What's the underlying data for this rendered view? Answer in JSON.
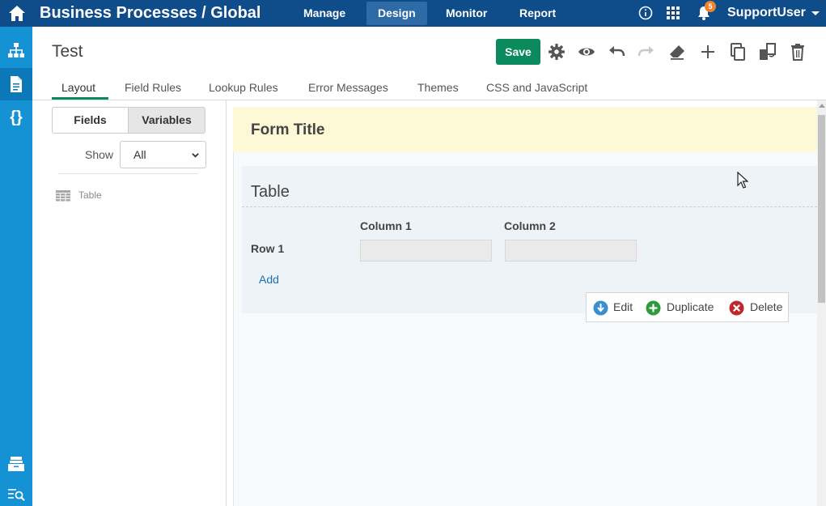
{
  "app": {
    "title": "Business Processes",
    "scope": "/ Global",
    "nav": [
      "Manage",
      "Design",
      "Monitor",
      "Report"
    ],
    "active_nav": "Design",
    "notifications_count": "5",
    "user": "SupportUser"
  },
  "rail": {
    "icons": [
      "hierarchy-icon",
      "document-icon",
      "braces-icon",
      "archive-icon",
      "search-list-icon"
    ],
    "active": "document-icon"
  },
  "header": {
    "page_title": "Test",
    "save_label": "Save",
    "tools": [
      "gear-icon",
      "eye-icon",
      "undo-icon",
      "redo-icon",
      "eraser-icon",
      "plus-icon",
      "copy-icon",
      "sync-icon",
      "trash-icon"
    ]
  },
  "tabs": [
    {
      "label": "Layout",
      "active": true
    },
    {
      "label": "Field Rules",
      "active": false
    },
    {
      "label": "Lookup Rules",
      "active": false
    },
    {
      "label": "Error Messages",
      "active": false
    },
    {
      "label": "Themes",
      "active": false
    },
    {
      "label": "CSS and JavaScript",
      "active": false
    }
  ],
  "left_panel": {
    "segments": [
      "Fields",
      "Variables"
    ],
    "active_segment": "Variables",
    "show_label": "Show",
    "show_value": "All",
    "tree_items": [
      {
        "label": "Table",
        "icon": "table-icon"
      }
    ]
  },
  "canvas": {
    "form_title": "Form Title",
    "table": {
      "title": "Table",
      "columns": [
        "Column 1",
        "Column 2"
      ],
      "rows": [
        {
          "label": "Row 1",
          "cells": [
            "",
            ""
          ]
        }
      ],
      "add_label": "Add"
    },
    "actions": [
      {
        "label": "Edit",
        "icon": "edit-arrow-icon",
        "color": "#3a8fd0"
      },
      {
        "label": "Duplicate",
        "icon": "plus-circle-icon",
        "color": "#2e9a3c"
      },
      {
        "label": "Delete",
        "icon": "x-circle-icon",
        "color": "#c0282d"
      }
    ]
  },
  "colors": {
    "topbar": "#0e4c8a",
    "rail": "#1592d4",
    "save": "#0b8a5e",
    "form_header": "#fdf9d7",
    "link": "#1a6fb5"
  }
}
